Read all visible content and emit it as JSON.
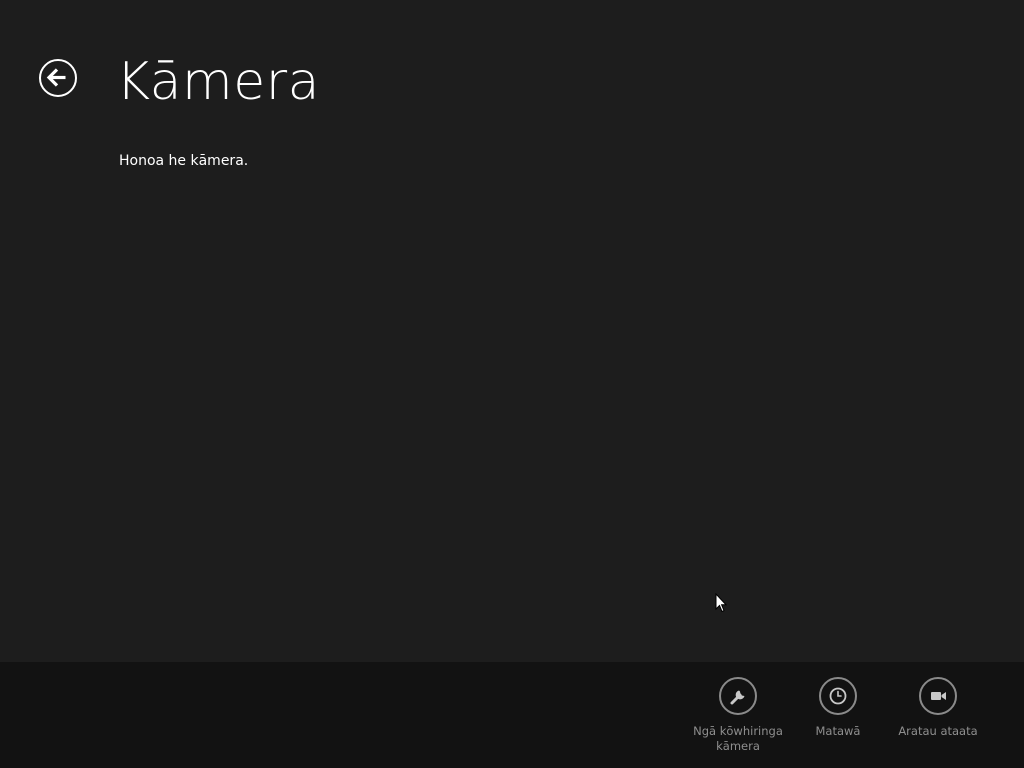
{
  "header": {
    "title": "Kāmera",
    "back_icon": "back-arrow-icon"
  },
  "main": {
    "message": "Honoa he kāmera."
  },
  "app_bar": {
    "buttons": [
      {
        "label": "Ngā kōwhiringa kāmera",
        "icon": "wrench-icon"
      },
      {
        "label": "Matawā",
        "icon": "clock-icon"
      },
      {
        "label": "Aratau ataata",
        "icon": "video-camera-icon"
      }
    ]
  },
  "colors": {
    "background": "#1d1d1d",
    "app_bar": "#121212",
    "text": "#ffffff",
    "app_bar_text": "#8e8e8e"
  }
}
